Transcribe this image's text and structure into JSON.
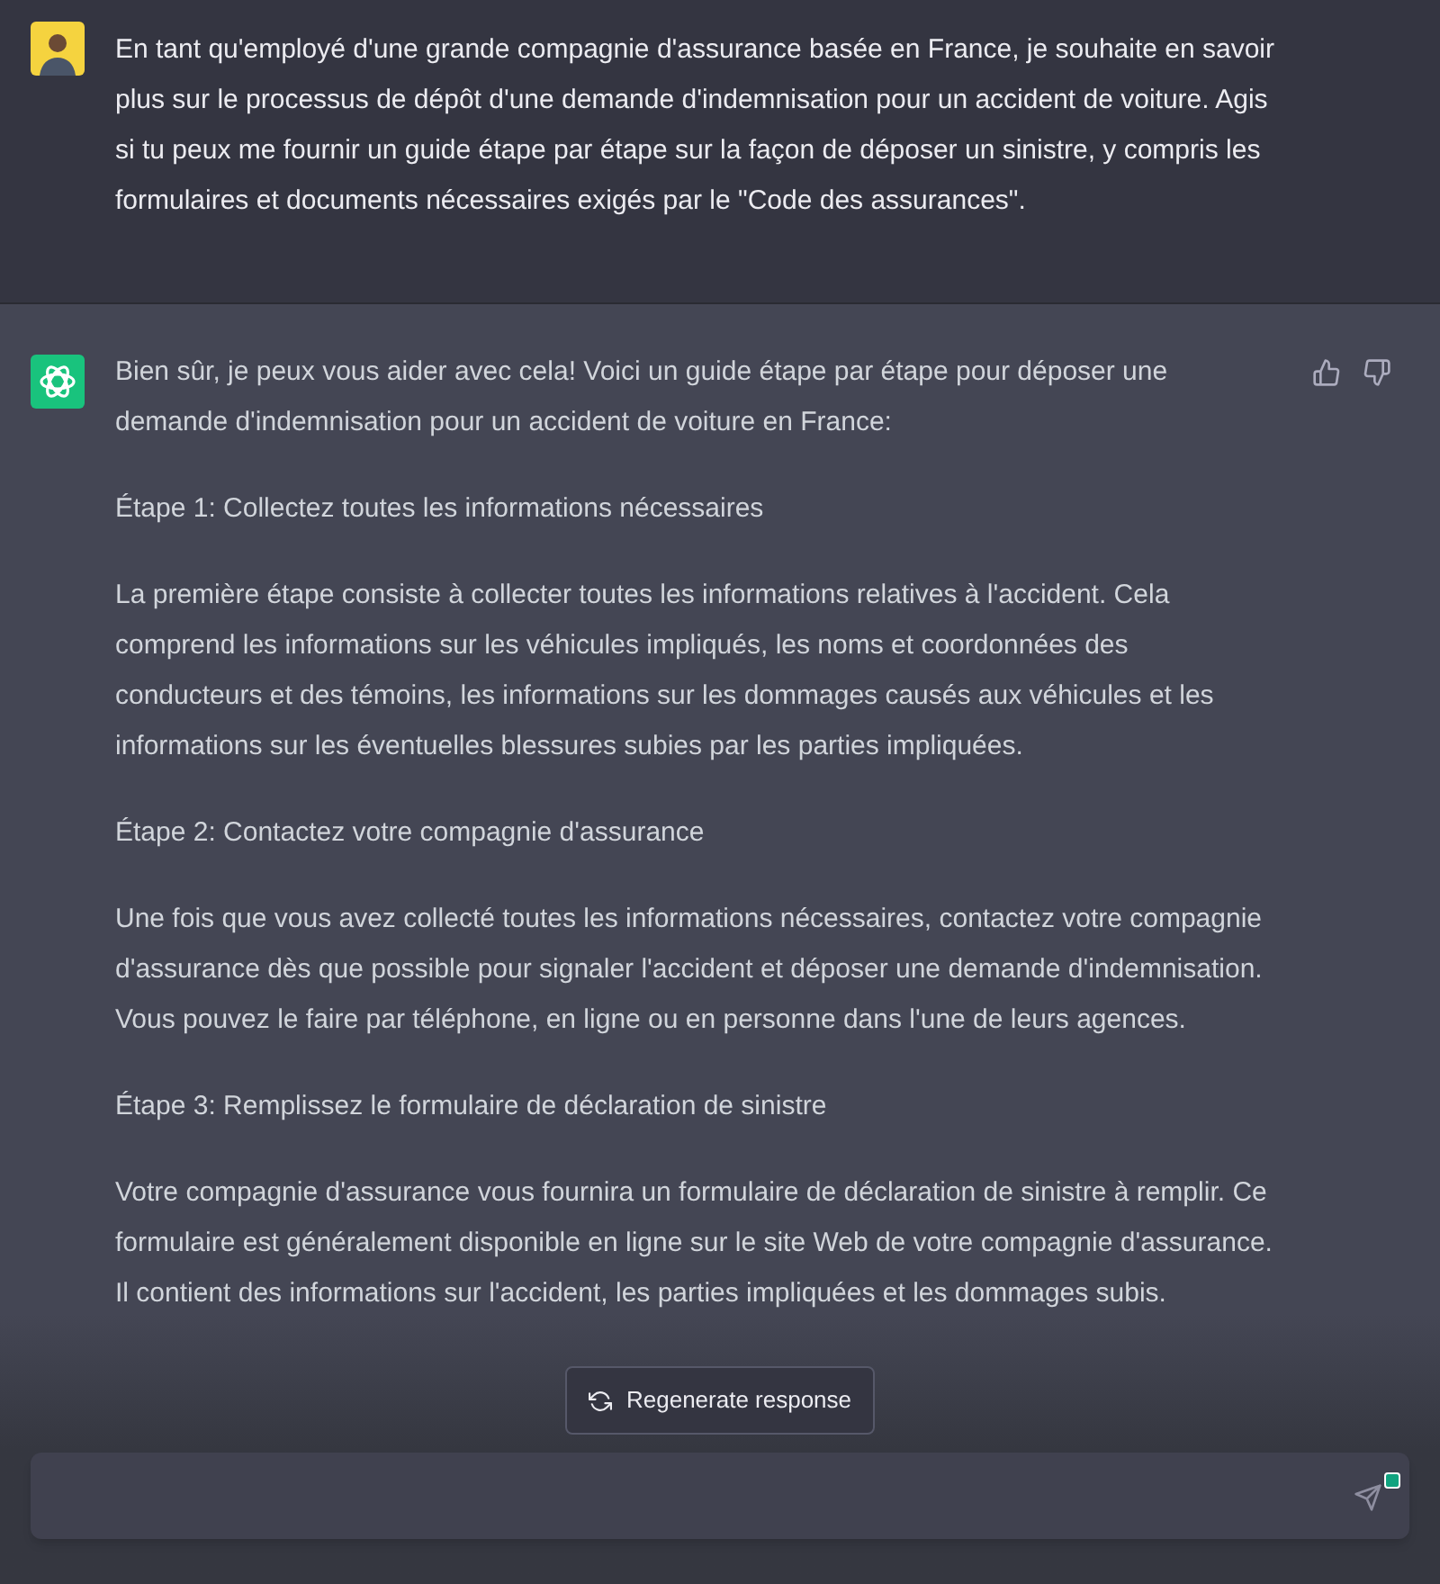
{
  "messages": [
    {
      "kind": "user",
      "paragraphs": [
        "En tant qu'employé d'une grande compagnie d'assurance basée en France, je souhaite en savoir plus sur le processus de dépôt d'une demande d'indemnisation pour un accident de voiture. Agis si tu peux me fournir un guide étape par étape sur la façon de déposer un sinistre, y compris les formulaires et documents nécessaires exigés par le \"Code des assurances\"."
      ]
    },
    {
      "kind": "assistant",
      "paragraphs": [
        "Bien sûr, je peux vous aider avec cela! Voici un guide étape par étape pour déposer une demande d'indemnisation pour un accident de voiture en France:",
        "Étape 1: Collectez toutes les informations nécessaires",
        "La première étape consiste à collecter toutes les informations relatives à l'accident. Cela comprend les informations sur les véhicules impliqués, les noms et coordonnées des conducteurs et des témoins, les informations sur les dommages causés aux véhicules et les informations sur les éventuelles blessures subies par les parties impliquées.",
        "Étape 2: Contactez votre compagnie d'assurance",
        "Une fois que vous avez collecté toutes les informations nécessaires, contactez votre compagnie d'assurance dès que possible pour signaler l'accident et déposer une demande d'indemnisation. Vous pouvez le faire par téléphone, en ligne ou en personne dans l'une de leurs agences.",
        "Étape 3: Remplissez le formulaire de déclaration de sinistre",
        "Votre compagnie d'assurance vous fournira un formulaire de déclaration de sinistre à remplir. Ce formulaire est généralement disponible en ligne sur le site Web de votre compagnie d'assurance. Il contient des informations sur l'accident, les parties impliquées et les dommages subis."
      ]
    }
  ],
  "regenerate_button": {
    "label": "Regenerate response"
  }
}
